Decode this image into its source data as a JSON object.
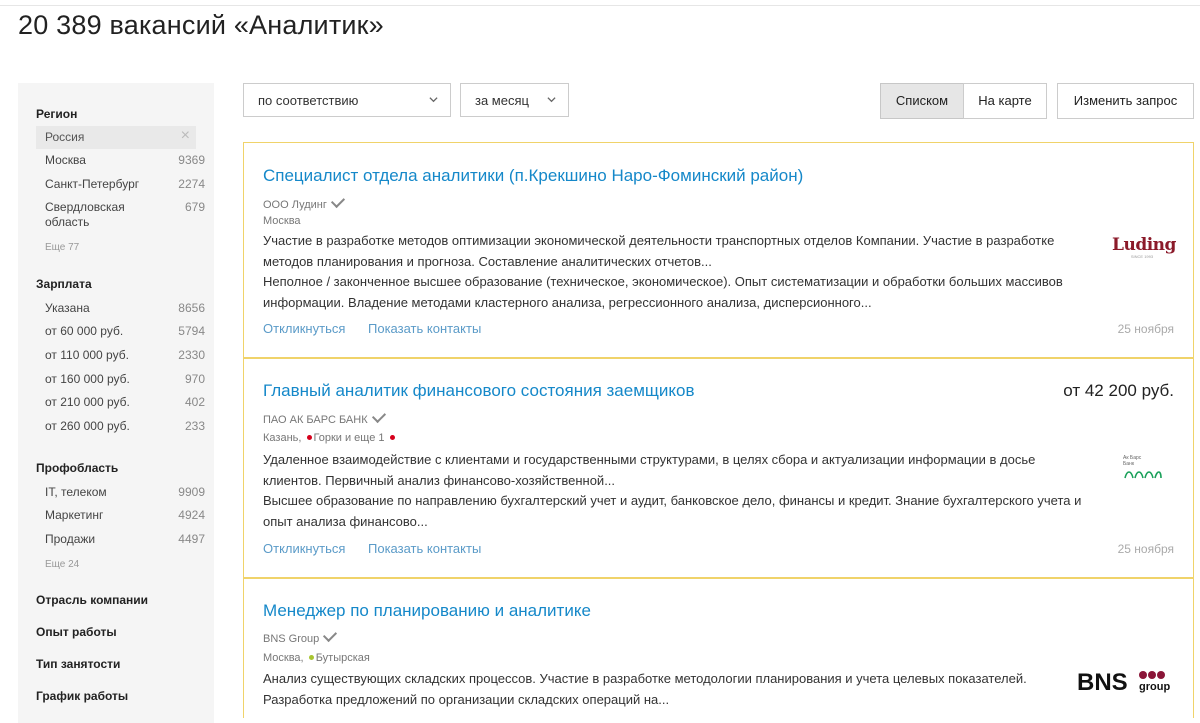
{
  "header": {
    "title": "20 389 вакансий «Аналитик»"
  },
  "sidebar": {
    "region": {
      "title": "Регион",
      "selected": "Россия",
      "items": [
        {
          "label": "Москва",
          "count": "9369"
        },
        {
          "label": "Санкт-Петербург",
          "count": "2274"
        },
        {
          "label": "Свердловская область",
          "count": "679"
        }
      ],
      "more": "Еще 77"
    },
    "salary": {
      "title": "Зарплата",
      "items": [
        {
          "label": "Указана",
          "count": "8656"
        },
        {
          "label": "от 60 000 руб.",
          "count": "5794"
        },
        {
          "label": "от 110 000 руб.",
          "count": "2330"
        },
        {
          "label": "от 160 000 руб.",
          "count": "970"
        },
        {
          "label": "от 210 000 руб.",
          "count": "402"
        },
        {
          "label": "от 260 000 руб.",
          "count": "233"
        }
      ]
    },
    "profarea": {
      "title": "Профобласть",
      "items": [
        {
          "label": "IT, телеком",
          "count": "9909"
        },
        {
          "label": "Маркетинг",
          "count": "4924"
        },
        {
          "label": "Продажи",
          "count": "4497"
        }
      ],
      "more": "Еще 24"
    },
    "industry": "Отрасль компании",
    "experience": "Опыт работы",
    "employment": "Тип занятости",
    "schedule": "График работы"
  },
  "toolbar": {
    "sort_value": "по соответствию",
    "period_value": "за месяц",
    "view_list": "Списком",
    "view_map": "На карте",
    "change_query": "Изменить запрос"
  },
  "vacancies": [
    {
      "title": "Специалист отдела аналитики (п.Крекшино Наро-Фоминский район)",
      "salary": "",
      "company": "ООО Лудинг",
      "city": "Москва",
      "metro": "",
      "desc1": "Участие в разработке методов оптимизации экономической деятельности транспортных отделов Компании. Участие в разработке методов планирования и прогноза. Составление аналитических отчетов...",
      "desc2": "Неполное / законченное высшее образование (техническое, экономическое). Опыт систематизации и обработки больших массивов информации. Владение методами кластерного анализа, регрессионного анализа, дисперсионного...",
      "respond": "Откликнуться",
      "contacts": "Показать контакты",
      "date": "25 ноября",
      "logo_text": "Luding",
      "logo_sub": "SINCE 1993"
    },
    {
      "title": "Главный аналитик финансового состояния заемщиков",
      "salary": "от 42 200 руб.",
      "company": "ПАО АК БАРС БАНК",
      "city": "Казань,",
      "metro": "Горки",
      "metro_more": "и еще 1",
      "desc1": "Удаленное взаимодействие с клиентами и государственными структурами, в целях сбора и актуализации информации в досье клиентов. Первичный анализ финансово-хозяйственной...",
      "desc2": "Высшее образование по направлению бухгалтерский учет и аудит, банковское дело, финансы и кредит. Знание бухгалтерского учета и опыт анализа финансово...",
      "respond": "Откликнуться",
      "contacts": "Показать контакты",
      "date": "25 ноября",
      "logo_text": "Ак Барс Банк"
    },
    {
      "title": "Менеджер по планированию и аналитике",
      "salary": "",
      "company": "BNS Group",
      "city": "Москва,",
      "metro": "Бутырская",
      "desc1": "Анализ существующих складских процессов. Участие в разработке методологии планирования и учета целевых показателей. Разработка предложений по организации складских операций на...",
      "logo_text": "BNS",
      "logo_sub": "group"
    }
  ],
  "colors": {
    "link": "#1588c9",
    "card_border": "#f0d36a",
    "metro_red": "#d6001c",
    "metro_green": "#a8c531"
  }
}
